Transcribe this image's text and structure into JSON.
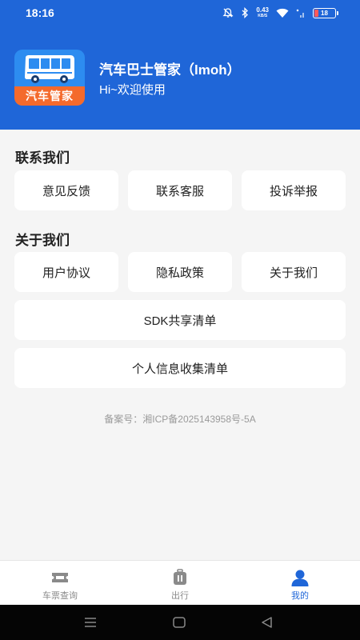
{
  "status_bar": {
    "time": "18:16",
    "net_speed_value": "0.43",
    "net_speed_unit": "KB/S",
    "battery": "18",
    "battery_level": 0.18
  },
  "app": {
    "logo_label": "汽车管家",
    "title": "汽车巴士管家（lmoh）",
    "greeting": "Hi~欢迎使用"
  },
  "contact": {
    "title": "联系我们",
    "buttons": [
      "意见反馈",
      "联系客服",
      "投诉举报"
    ]
  },
  "about": {
    "title": "关于我们",
    "buttons": [
      "用户协议",
      "隐私政策",
      "关于我们"
    ],
    "sdk_list": "SDK共享清单",
    "personal_info_list": "个人信息收集清单"
  },
  "record_number": "备案号：湘ICP备2025143958号-5A",
  "tabbar": {
    "tabs": [
      {
        "label": "车票查询",
        "icon": "ticket-icon"
      },
      {
        "label": "出行",
        "icon": "luggage-icon"
      },
      {
        "label": "我的",
        "icon": "person-icon"
      }
    ],
    "active_index": 2
  },
  "colors": {
    "primary": "#1f66d8",
    "logo_bg": "#2d8cf0",
    "logo_label_bg": "#f46a2c",
    "inactive": "#8a8a8a"
  }
}
